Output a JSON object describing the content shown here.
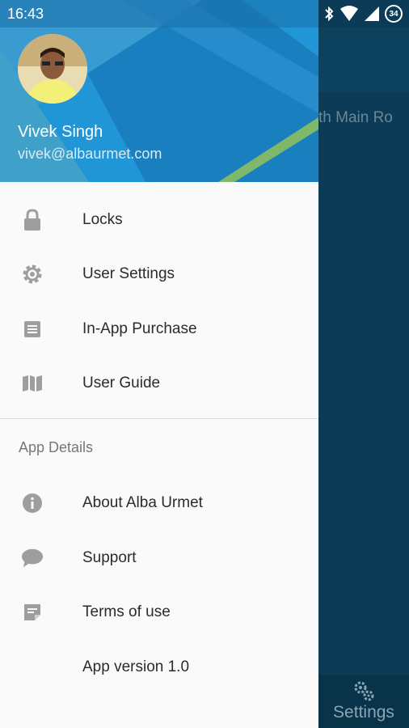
{
  "status_bar": {
    "time": "16:43",
    "battery_level": "34"
  },
  "background_app": {
    "address_fragment": "th Main Ro",
    "bottom_tab_label": "Settings"
  },
  "drawer": {
    "user": {
      "name": "Vivek Singh",
      "email": "vivek@albaurmet.com"
    },
    "menu": [
      {
        "label": "Locks",
        "icon": "lock-icon"
      },
      {
        "label": "User Settings",
        "icon": "gear-icon"
      },
      {
        "label": "In-App Purchase",
        "icon": "list-icon"
      },
      {
        "label": "User Guide",
        "icon": "map-icon"
      }
    ],
    "section_title": "App Details",
    "details": [
      {
        "label": "About Alba Urmet",
        "icon": "info-icon"
      },
      {
        "label": "Support",
        "icon": "chat-bubble-icon"
      },
      {
        "label": "Terms of use",
        "icon": "document-icon"
      },
      {
        "label": "App version 1.0",
        "icon": ""
      }
    ]
  },
  "colors": {
    "drawer_header": "#1e88c8",
    "background_app": "#0b3b56",
    "icon_gray": "#9e9e9e"
  }
}
